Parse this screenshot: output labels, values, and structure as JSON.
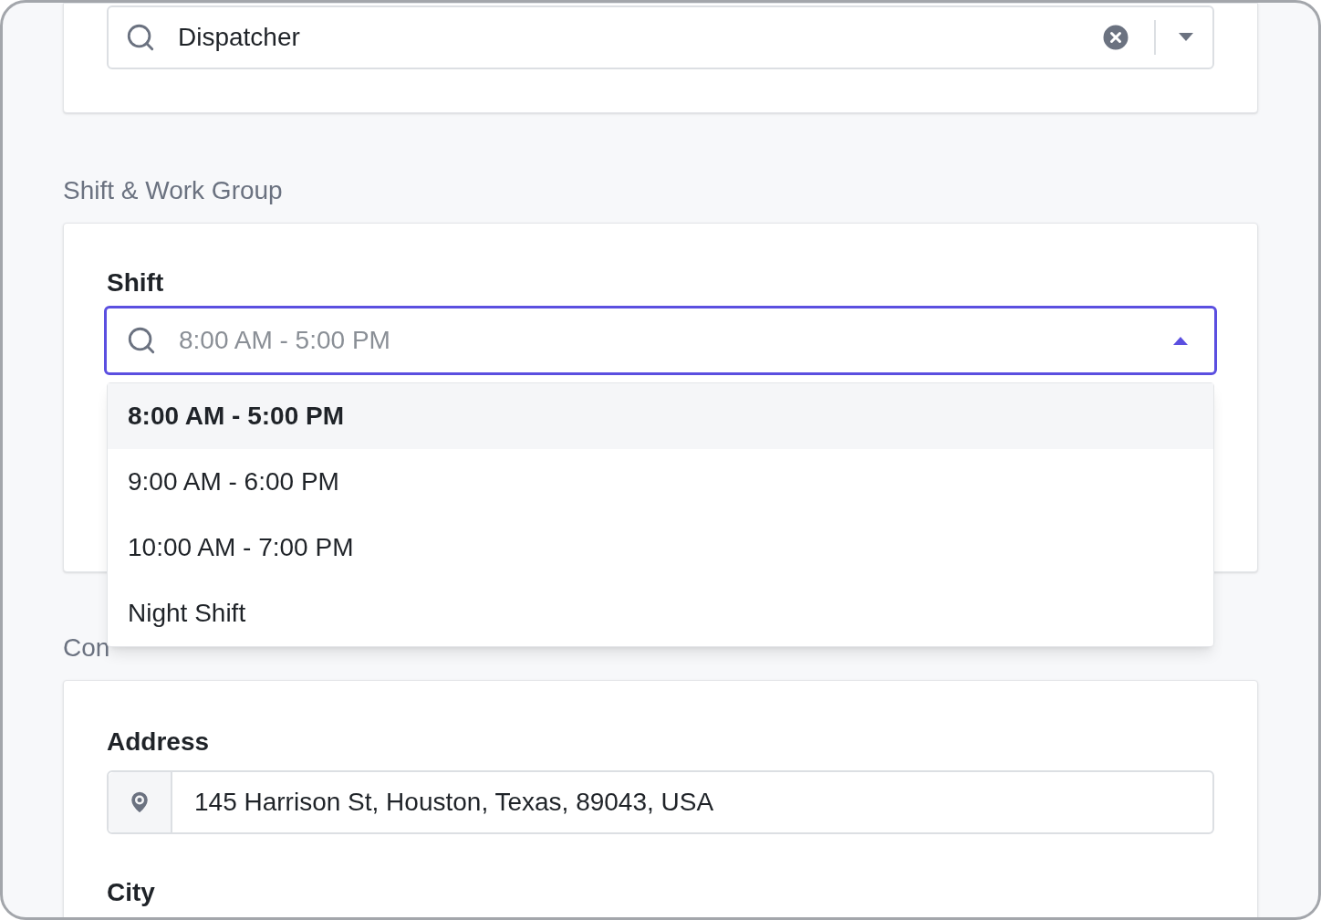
{
  "role_field": {
    "value": "Dispatcher"
  },
  "sections": [
    {
      "title": "Shift & Work Group"
    },
    {
      "title": "Con"
    }
  ],
  "shift": {
    "label": "Shift",
    "placeholder": "8:00 AM - 5:00 PM",
    "expanded": true,
    "options": [
      {
        "label": "8:00 AM - 5:00 PM",
        "selected": true
      },
      {
        "label": "9:00 AM - 6:00 PM",
        "selected": false
      },
      {
        "label": "10:00 AM - 7:00 PM",
        "selected": false
      },
      {
        "label": "Night Shift",
        "selected": false
      }
    ]
  },
  "address": {
    "label": "Address",
    "value": "145 Harrison St, Houston, Texas, 89043, USA"
  },
  "city": {
    "label": "City"
  }
}
